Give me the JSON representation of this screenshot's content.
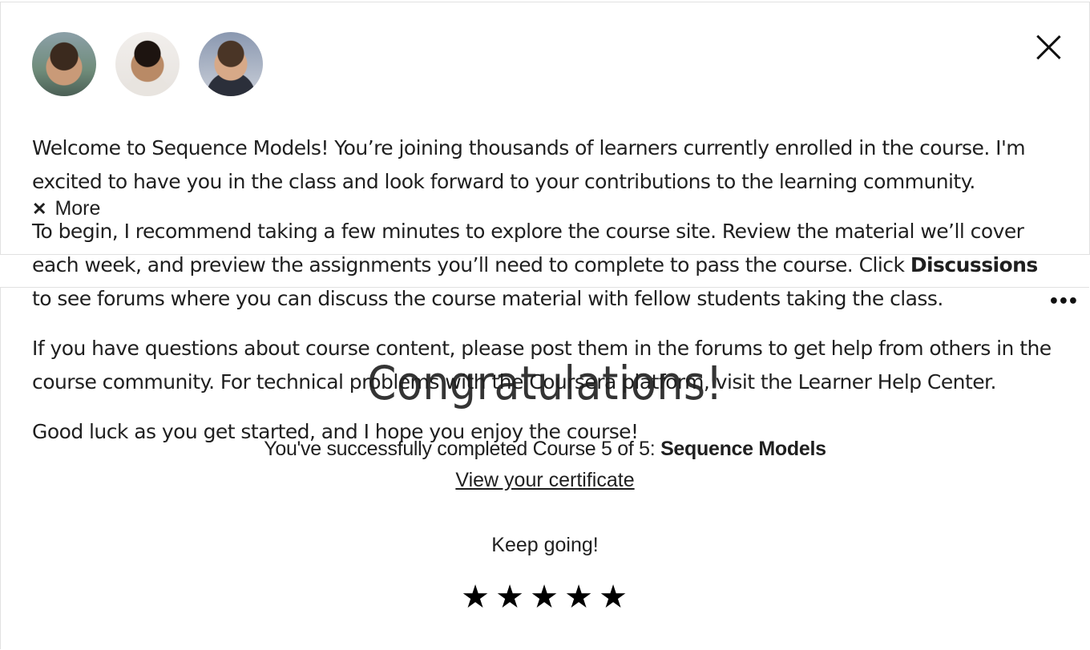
{
  "welcome": {
    "paragraphs": [
      "Welcome to Sequence Models! You’re joining thousands of learners currently enrolled in the course. I'm excited to have you in the class and look forward to your contributions to the learning community.",
      "To begin, I recommend taking a few minutes to explore the course site. Review the material we’ll cover each week, and preview the assignments you’ll need to complete to pass the course. Click",
      "Discussions",
      "to see forums where you can discuss the course material with fellow students taking the class.",
      "If you have questions about course content, please post them in the forums to get help from others in the course community. For technical problems with the Coursera platform, visit the Learner Help Center.",
      "Good luck as you get started, and I hope you enjoy the course!"
    ],
    "more_label": "More",
    "icons": {
      "close": "close-icon",
      "more_chevron": "chevron-down-icon"
    }
  },
  "congrats": {
    "title": "Congratulations!",
    "line_prefix": "You've successfully completed Course 5 of 5: ",
    "course_name": "Sequence Models",
    "certificate_link": "View your certificate",
    "keep_going": "Keep going!",
    "stars": [
      "★",
      "★",
      "★",
      "★",
      "★"
    ],
    "menu_icon": "more-options-icon"
  }
}
